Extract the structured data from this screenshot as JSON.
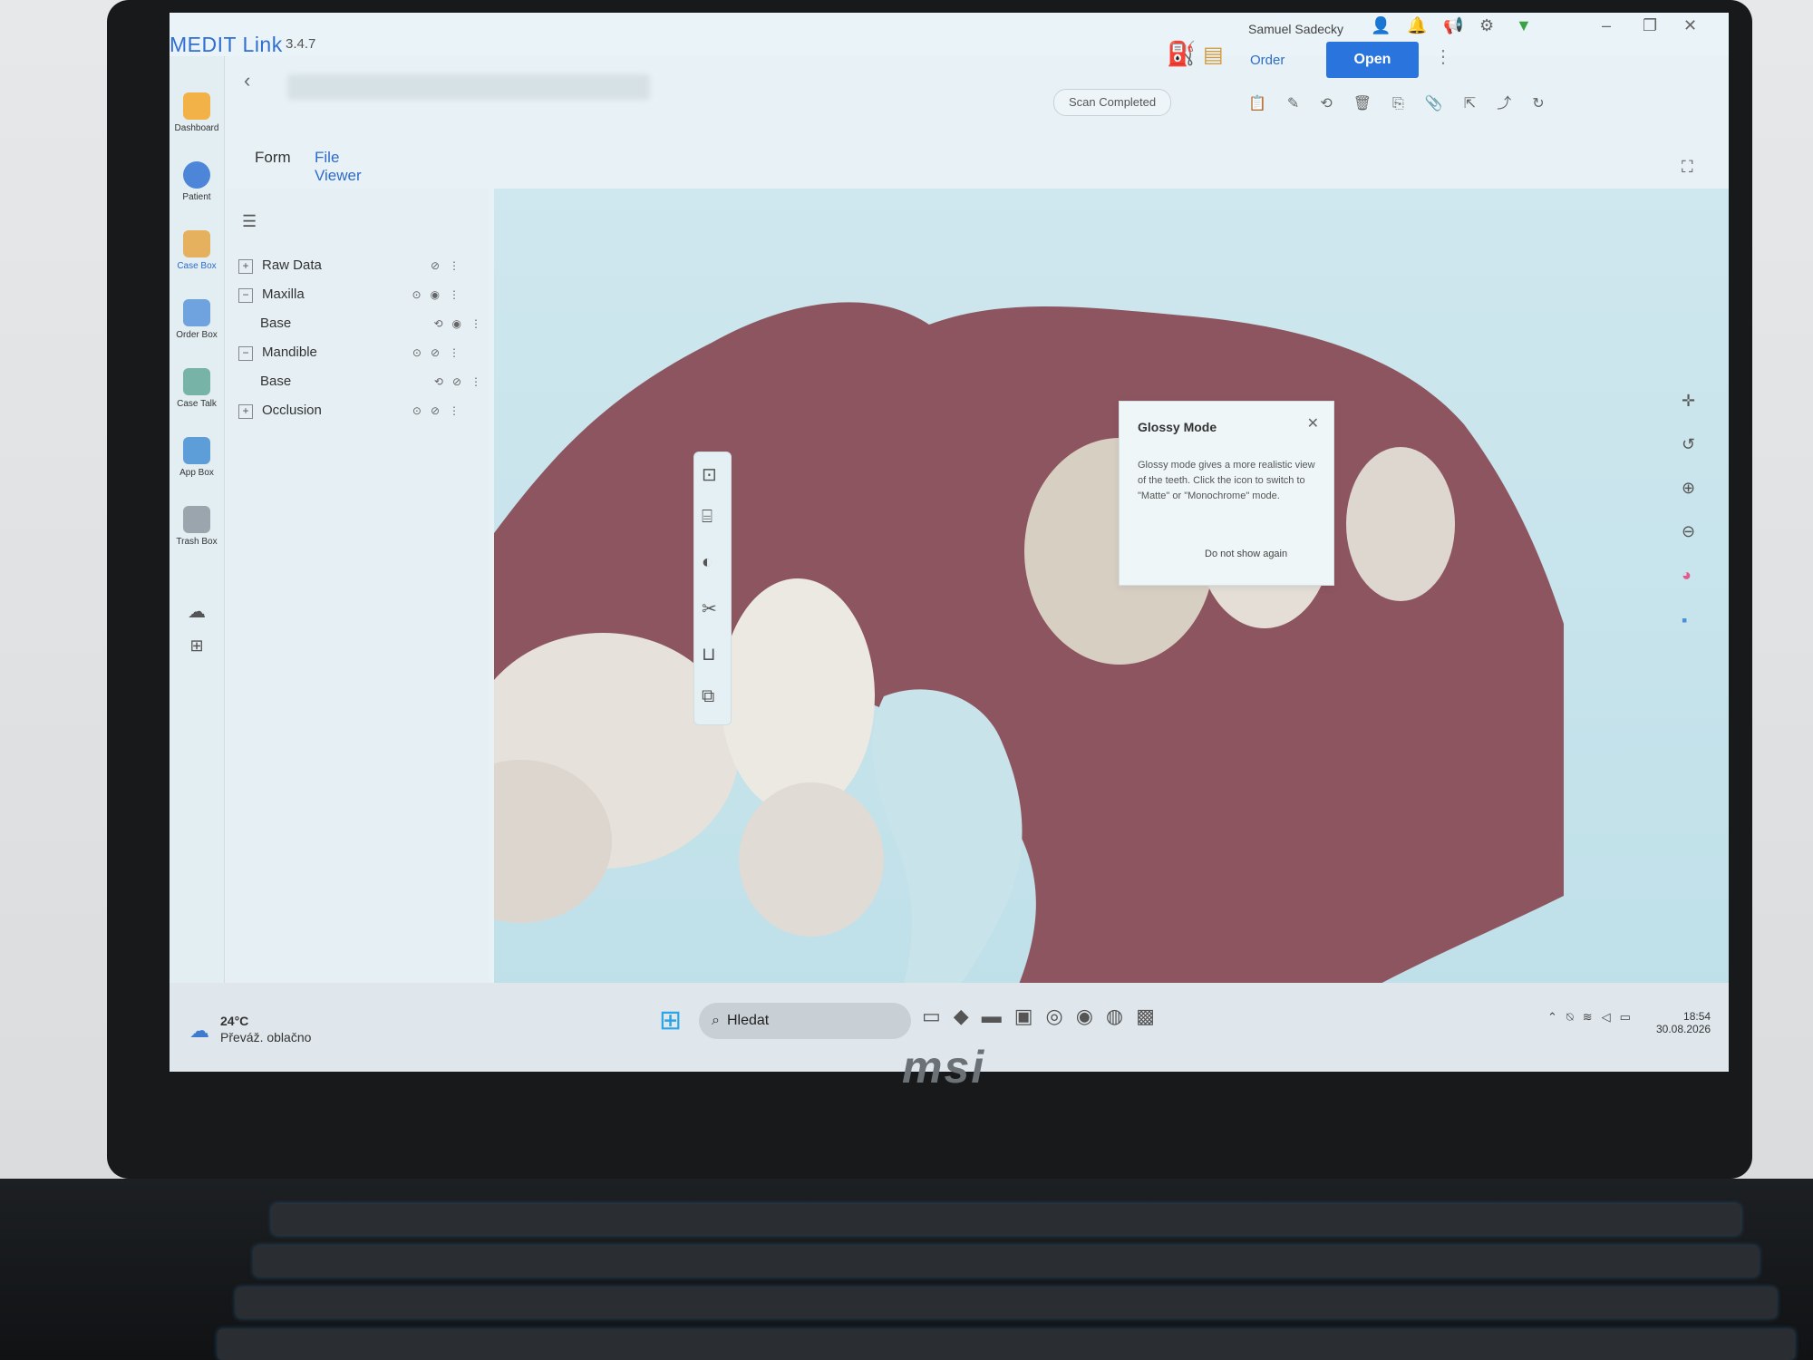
{
  "app": {
    "brand": "MEDIT Link",
    "version": "3.4.7",
    "user_name": "Samuel Sadecky"
  },
  "header": {
    "back_icon": "chevron-left-icon",
    "order_label": "Order",
    "open_label": "Open",
    "status": "Scan Completed"
  },
  "sidebar": {
    "items": [
      {
        "label": "Dashboard",
        "icon": "chart-icon"
      },
      {
        "label": "Patient",
        "icon": "user-icon"
      },
      {
        "label": "Case Box",
        "icon": "case-box-icon"
      },
      {
        "label": "Order Box",
        "icon": "order-box-icon"
      },
      {
        "label": "Case Talk",
        "icon": "chat-icon"
      },
      {
        "label": "App Box",
        "icon": "app-box-icon"
      },
      {
        "label": "Trash Box",
        "icon": "trash-icon"
      }
    ]
  },
  "tabs": [
    {
      "label": "Form",
      "active": false
    },
    {
      "label": "File Viewer",
      "active": true
    }
  ],
  "tree": {
    "rows": [
      {
        "label": "Raw Data",
        "toggle": "+",
        "indent": 0
      },
      {
        "label": "Maxilla",
        "toggle": "−",
        "indent": 0
      },
      {
        "label": "Base",
        "toggle": "",
        "indent": 1
      },
      {
        "label": "Mandible",
        "toggle": "−",
        "indent": 0
      },
      {
        "label": "Base",
        "toggle": "",
        "indent": 1
      },
      {
        "label": "Occlusion",
        "toggle": "+",
        "indent": 0
      }
    ]
  },
  "glossy_popup": {
    "title": "Glossy Mode",
    "description": "Glossy mode gives a more realistic view of the teeth. Click the icon to switch to \"Matte\" or \"Monochrome\" mode.",
    "dont_show": "Do not show again"
  },
  "taskbar": {
    "search_placeholder": "Hledat",
    "weather_temp": "24°C",
    "weather_desc": "Převáž. oblačno",
    "time": "18:54",
    "date": "30.08.2026"
  },
  "laptop_brand": "msi",
  "colors": {
    "accent": "#2a74de",
    "gum": "#8d5560",
    "tooth": "#e8e3dc"
  }
}
